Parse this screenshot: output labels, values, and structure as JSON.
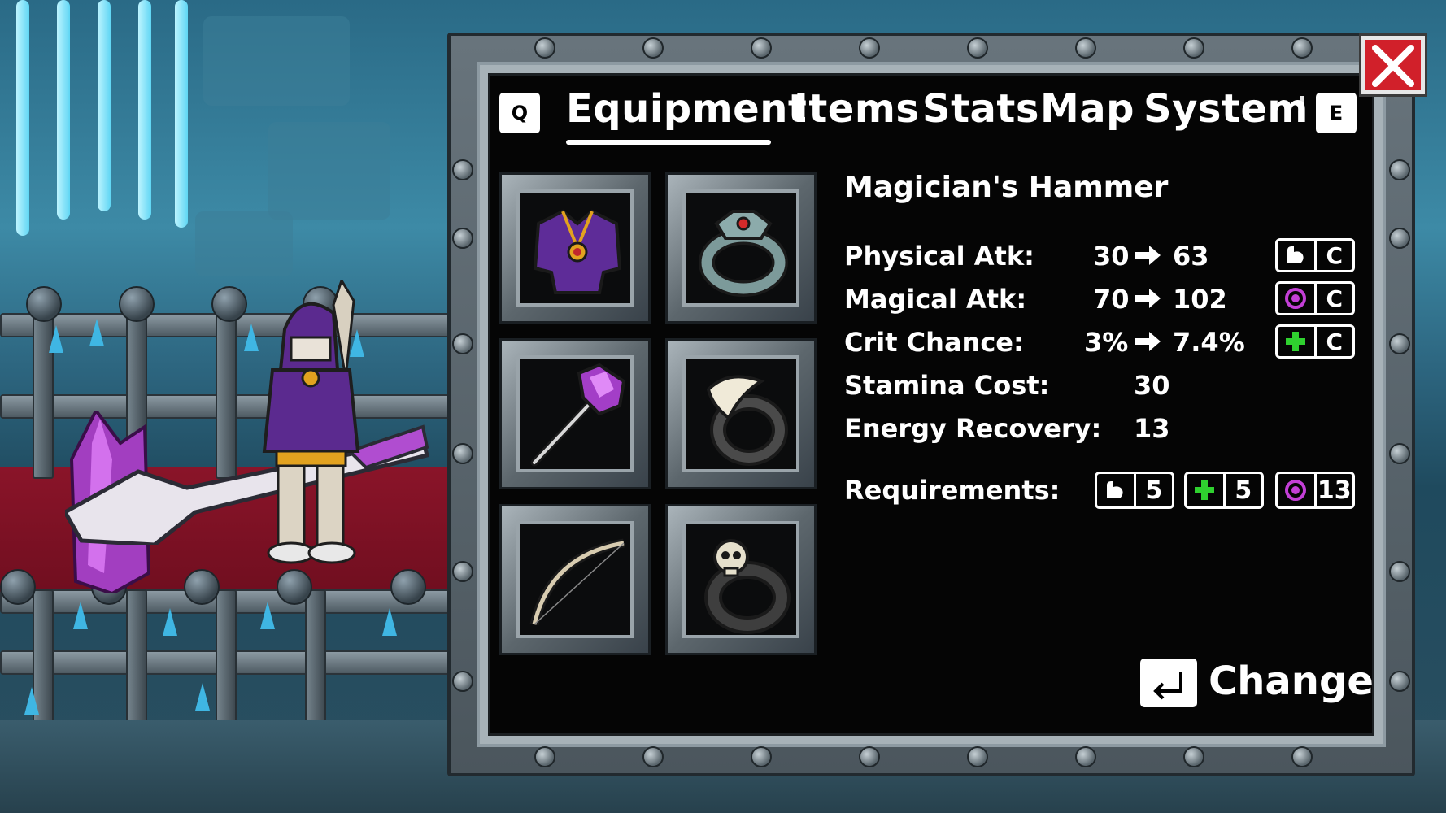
{
  "tabs": {
    "prev_key": "Q",
    "next_key": "E",
    "items": [
      "Equipment",
      "Items",
      "Stats",
      "Map",
      "System"
    ],
    "active": "Equipment"
  },
  "equipment_slots": [
    {
      "slot": "armor",
      "icon": "purple-armor-icon"
    },
    {
      "slot": "ring-1",
      "icon": "jeweled-ring-icon"
    },
    {
      "slot": "weapon",
      "icon": "crystal-hammer-icon"
    },
    {
      "slot": "ring-2",
      "icon": "fang-ring-icon"
    },
    {
      "slot": "offhand",
      "icon": "bone-bow-icon"
    },
    {
      "slot": "ring-3",
      "icon": "skull-ring-icon"
    }
  ],
  "item": {
    "name": "Magician's Hammer",
    "stats": [
      {
        "label": "Physical Atk:",
        "from": "30",
        "to": "63",
        "scale_icon": "strength-icon",
        "scale": "C"
      },
      {
        "label": "Magical Atk:",
        "from": "70",
        "to": "102",
        "scale_icon": "magic-icon",
        "scale": "C"
      },
      {
        "label": "Crit Chance:",
        "from": "3%",
        "to": "7.4%",
        "scale_icon": "dexterity-icon",
        "scale": "C"
      }
    ],
    "stamina_cost": {
      "label": "Stamina Cost:",
      "value": "30"
    },
    "energy_recovery": {
      "label": "Energy Recovery:",
      "value": "13"
    },
    "requirements": {
      "label": "Requirements:",
      "items": [
        {
          "icon": "strength-icon",
          "value": "5"
        },
        {
          "icon": "dexterity-icon",
          "value": "5"
        },
        {
          "icon": "magic-icon",
          "value": "13"
        }
      ]
    }
  },
  "actions": {
    "change_label": "Change"
  },
  "colors": {
    "magic": "#c33fd6",
    "dexterity": "#2fd12f",
    "close": "#d1202a"
  }
}
